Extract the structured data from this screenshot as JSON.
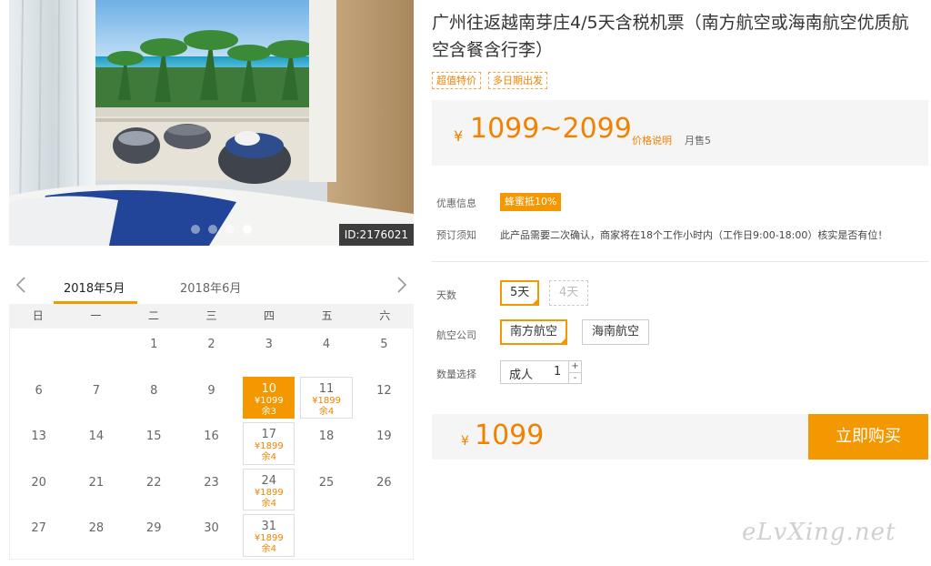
{
  "hero": {
    "image_id": "ID:2176021",
    "slide_count": 4,
    "active_slide": 4
  },
  "calendar": {
    "months": [
      "2018年5月",
      "2018年6月"
    ],
    "active_month": "2018年5月",
    "weekdays": [
      "日",
      "一",
      "二",
      "三",
      "四",
      "五",
      "六"
    ],
    "days": [
      {
        "d": ""
      },
      {
        "d": ""
      },
      {
        "d": "1"
      },
      {
        "d": "2"
      },
      {
        "d": "3"
      },
      {
        "d": "4"
      },
      {
        "d": "5"
      },
      {
        "d": "6"
      },
      {
        "d": "7"
      },
      {
        "d": "8"
      },
      {
        "d": "9"
      },
      {
        "d": "10",
        "price": "¥1099",
        "left": "余3",
        "selected": true
      },
      {
        "d": "11",
        "price": "¥1899",
        "left": "余4"
      },
      {
        "d": "12"
      },
      {
        "d": "13"
      },
      {
        "d": "14"
      },
      {
        "d": "15"
      },
      {
        "d": "16"
      },
      {
        "d": "17",
        "price": "¥1899",
        "left": "余4"
      },
      {
        "d": "18"
      },
      {
        "d": "19"
      },
      {
        "d": "20"
      },
      {
        "d": "21"
      },
      {
        "d": "22"
      },
      {
        "d": "23"
      },
      {
        "d": "24",
        "price": "¥1899",
        "left": "余4"
      },
      {
        "d": "25"
      },
      {
        "d": "26"
      },
      {
        "d": "27"
      },
      {
        "d": "28"
      },
      {
        "d": "29"
      },
      {
        "d": "30"
      },
      {
        "d": "31",
        "price": "¥1899",
        "left": "余4"
      },
      {
        "d": ""
      },
      {
        "d": ""
      }
    ]
  },
  "product": {
    "title": "广州往返越南芽庄4/5天含税机票（南方航空或海南航空优质航空含餐含行李）",
    "tags": [
      "超值特价",
      "多日期出发"
    ],
    "currency": "¥",
    "price_range": "1099~2099",
    "price_explain": "价格说明",
    "monthly_sales": "月售5"
  },
  "promo": {
    "label": "优惠信息",
    "badge": "蜂蜜抵10%"
  },
  "notice": {
    "label": "预订须知",
    "text": "此产品需要二次确认，商家将在18个工作小时内（工作日9:00-18:00）核实是否有位！"
  },
  "options": {
    "days_label": "天数",
    "days": [
      "5天",
      "4天"
    ],
    "airline_label": "航空公司",
    "airlines": [
      "南方航空",
      "海南航空"
    ],
    "qty_label": "数量选择",
    "qty_type": "成人",
    "qty_value": "1",
    "qty_plus": "+",
    "qty_minus": "-"
  },
  "purchase": {
    "currency": "¥",
    "price": "1099",
    "buy_label": "立即购买"
  },
  "watermark": "eLvXing.net",
  "colors": {
    "accent": "#f39800",
    "accent_text": "#f08200",
    "panel_bg": "#f5f5f5"
  }
}
